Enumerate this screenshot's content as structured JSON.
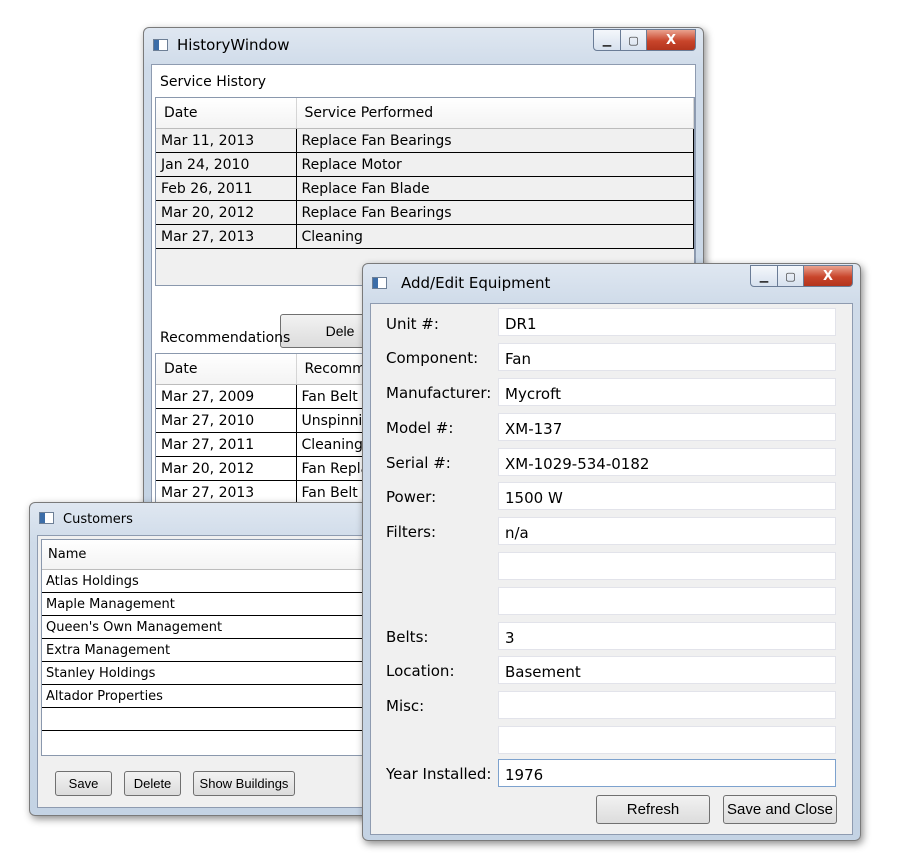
{
  "history_window": {
    "title": "HistoryWindow",
    "service_history_label": "Service History",
    "service_columns": [
      "Date",
      "Service Performed"
    ],
    "service_rows": [
      [
        "Mar 11, 2013",
        "Replace Fan Bearings"
      ],
      [
        "Jan 24, 2010",
        "Replace Motor"
      ],
      [
        "Feb 26, 2011",
        "Replace Fan Blade"
      ],
      [
        "Mar 20, 2012",
        "Replace Fan Bearings"
      ],
      [
        "Mar 27, 2013",
        "Cleaning"
      ]
    ],
    "delete_button_label": "Dele",
    "recommendations_label": "Recommendations",
    "recommendation_columns": [
      "Date",
      "Recomm"
    ],
    "recommendation_rows": [
      [
        "Mar 27, 2009",
        "Fan Belt F"
      ],
      [
        "Mar 27, 2010",
        "Unspinnir"
      ],
      [
        "Mar 27, 2011",
        "Cleaning"
      ],
      [
        "Mar 20, 2012",
        "Fan Repla"
      ],
      [
        "Mar 27, 2013",
        "Fan Belt F"
      ]
    ]
  },
  "customers_window": {
    "title": "Customers",
    "column": "Name",
    "rows": [
      "Atlas Holdings",
      "Maple Management",
      "Queen's Own Management",
      "Extra Management",
      "Stanley Holdings",
      "Altador Properties"
    ],
    "save_label": "Save",
    "delete_label": "Delete",
    "show_buildings_label": "Show Buildings"
  },
  "equipment_window": {
    "title": "Add/Edit Equipment",
    "unit_label": "Unit #:",
    "unit_value": "DR1",
    "component_label": "Component:",
    "component_value": "Fan",
    "manufacturer_label": "Manufacturer:",
    "manufacturer_value": "Mycroft",
    "model_label": "Model #:",
    "model_value": "XM-137",
    "serial_label": "Serial #:",
    "serial_value": "XM-1029-534-0182",
    "power_label": "Power:",
    "power_value": "1500 W",
    "filters_label": "Filters:",
    "filters_value_1": "n/a",
    "filters_value_2": "",
    "filters_value_3": "",
    "belts_label": "Belts:",
    "belts_value": "3",
    "location_label": "Location:",
    "location_value": "Basement",
    "misc_label": "Misc:",
    "misc_value_1": "",
    "misc_value_2": "",
    "year_label": "Year Installed:",
    "year_value": "1976",
    "refresh_label": "Refresh",
    "save_close_label": "Save and Close"
  },
  "window_controls": {
    "minimize": "▁",
    "maximize": "▢",
    "close": "X"
  }
}
